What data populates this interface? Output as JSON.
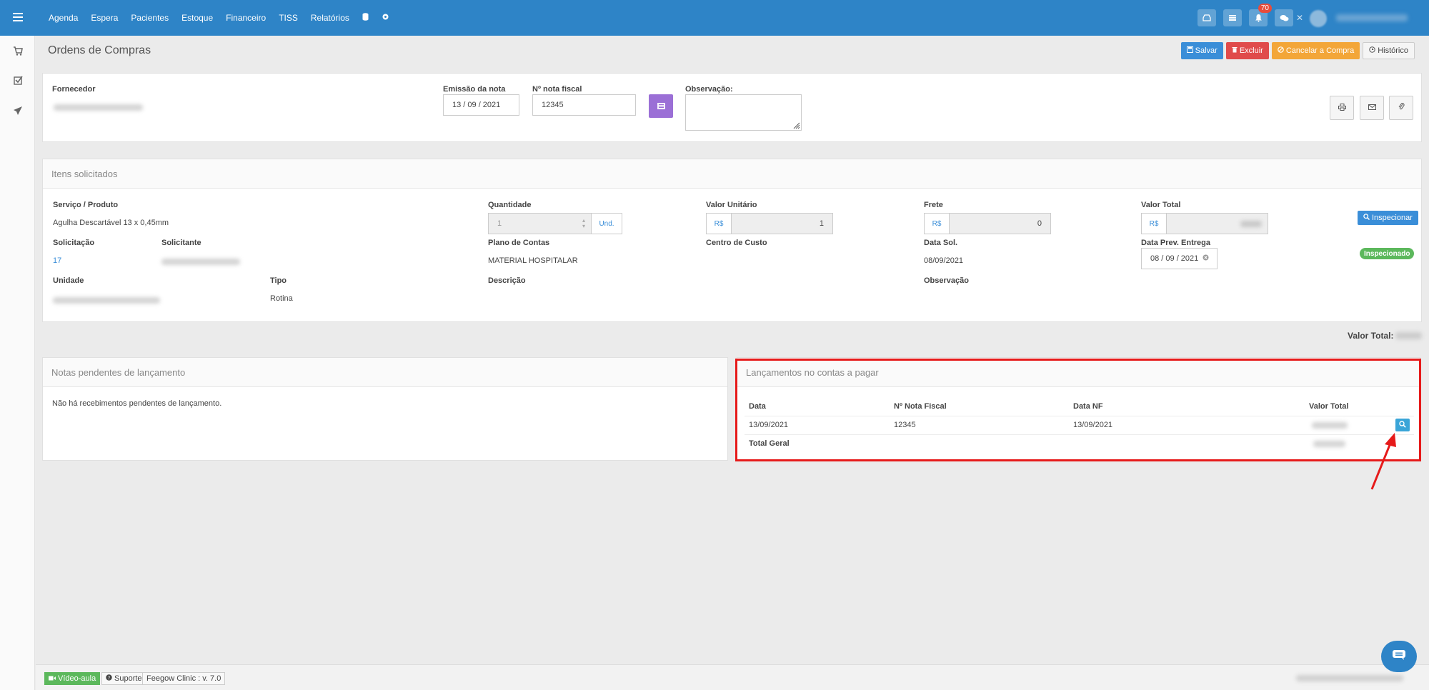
{
  "nav": {
    "items": [
      "Agenda",
      "Espera",
      "Pacientes",
      "Estoque",
      "Financeiro",
      "TISS",
      "Relatórios"
    ],
    "notification_count": "70"
  },
  "page": {
    "title": "Ordens de Compras",
    "buttons": {
      "save": "Salvar",
      "delete": "Excluir",
      "cancel": "Cancelar a Compra",
      "history": "Histórico"
    }
  },
  "order": {
    "supplier_label": "Fornecedor",
    "issue_label": "Emissão da nota",
    "issue_value": "13 / 09 / 2021",
    "invoice_label": "Nº nota fiscal",
    "invoice_value": "12345",
    "obs_label": "Observação:"
  },
  "items": {
    "title": "Itens solicitados",
    "service_label": "Serviço / Produto",
    "service_value": "Agulha Descartável 13 x 0,45mm",
    "qty_label": "Quantidade",
    "qty_value": "1",
    "qty_unit": "Und.",
    "unit_price_label": "Valor Unitário",
    "currency": "R$",
    "unit_price_value": "1",
    "freight_label": "Frete",
    "freight_value": "0",
    "total_label": "Valor Total",
    "inspect_button": "Inspecionar",
    "inspected_badge": "Inspecionado",
    "request_label": "Solicitação",
    "request_value": "17",
    "requester_label": "Solicitante",
    "account_plan_label": "Plano de Contas",
    "account_plan_value": "MATERIAL HOSPITALAR",
    "cost_center_label": "Centro de Custo",
    "request_date_label": "Data Sol.",
    "request_date_value": "08/09/2021",
    "delivery_label": "Data Prev. Entrega",
    "delivery_value": "08 / 09 / 2021",
    "unit_label": "Unidade",
    "type_label": "Tipo",
    "type_value": "Rotina",
    "description_label": "Descrição",
    "observation_label": "Observação"
  },
  "grand_total_label": "Valor Total:",
  "pending": {
    "title": "Notas pendentes de lançamento",
    "message": "Não há recebimentos pendentes de lançamento."
  },
  "payables": {
    "title": "Lançamentos no contas a pagar",
    "columns": [
      "Data",
      "Nº Nota Fiscal",
      "Data NF",
      "Valor Total"
    ],
    "rows": [
      {
        "date": "13/09/2021",
        "invoice": "12345",
        "invoice_date": "13/09/2021"
      }
    ],
    "total_label": "Total Geral"
  },
  "footer": {
    "video": "Vídeo-aula",
    "support": "Suporte",
    "version": "Feegow Clinic : v. 7.0"
  },
  "colors": {
    "topbar": "#2e84c7",
    "highlight": "#e61a1a",
    "success": "#5cb85c",
    "purple": "#9b6fd6"
  }
}
